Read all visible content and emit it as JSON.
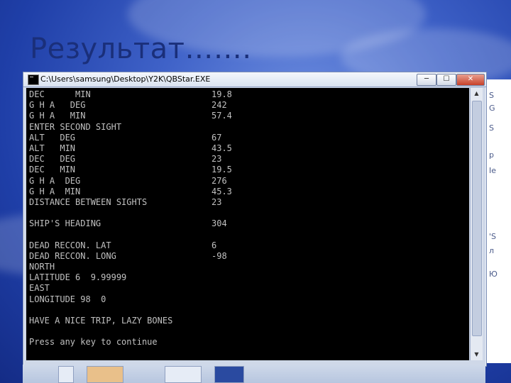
{
  "slide": {
    "title": "Результат……."
  },
  "window": {
    "title": "C:\\Users\\samsung\\Desktop\\Y2K\\QBStar.EXE",
    "buttons": {
      "minimize": "─",
      "maximize": "☐",
      "close": "✕"
    }
  },
  "console": {
    "lines": [
      {
        "label": "DEC      MIN",
        "value": "19.8"
      },
      {
        "label": "G H A   DEG",
        "value": "242"
      },
      {
        "label": "G H A   MIN",
        "value": "57.4"
      },
      {
        "label": "ENTER SECOND SIGHT",
        "value": ""
      },
      {
        "label": "ALT   DEG",
        "value": "67"
      },
      {
        "label": "ALT   MIN",
        "value": "43.5"
      },
      {
        "label": "DEC   DEG",
        "value": "23"
      },
      {
        "label": "DEC   MIN",
        "value": "19.5"
      },
      {
        "label": "G H A  DEG",
        "value": "276"
      },
      {
        "label": "G H A  MIN",
        "value": "45.3"
      },
      {
        "label": "DISTANCE BETWEEN SIGHTS",
        "value": "23"
      },
      {
        "label": "",
        "value": ""
      },
      {
        "label": "SHIP'S HEADING",
        "value": "304"
      },
      {
        "label": "",
        "value": ""
      },
      {
        "label": "DEAD RECCON. LAT",
        "value": "6"
      },
      {
        "label": "DEAD RECCON. LONG",
        "value": "-98"
      },
      {
        "label": "NORTH",
        "value": ""
      },
      {
        "label": "LATITUDE 6  9.99999",
        "value": ""
      },
      {
        "label": "EAST",
        "value": ""
      },
      {
        "label": "LONGITUDE 98  0",
        "value": ""
      },
      {
        "label": "",
        "value": ""
      },
      {
        "label": "HAVE A NICE TRIP, LAZY BONES",
        "value": ""
      },
      {
        "label": "",
        "value": ""
      },
      {
        "label": "Press any key to continue",
        "value": ""
      }
    ]
  },
  "background_window": {
    "fragments": [
      "S",
      "G",
      "S",
      "p",
      "Ie",
      "'S",
      "л",
      "Ю"
    ]
  },
  "colors": {
    "console_bg": "#000000",
    "console_text": "#c0c0c0",
    "title": "#1a2f7a"
  }
}
